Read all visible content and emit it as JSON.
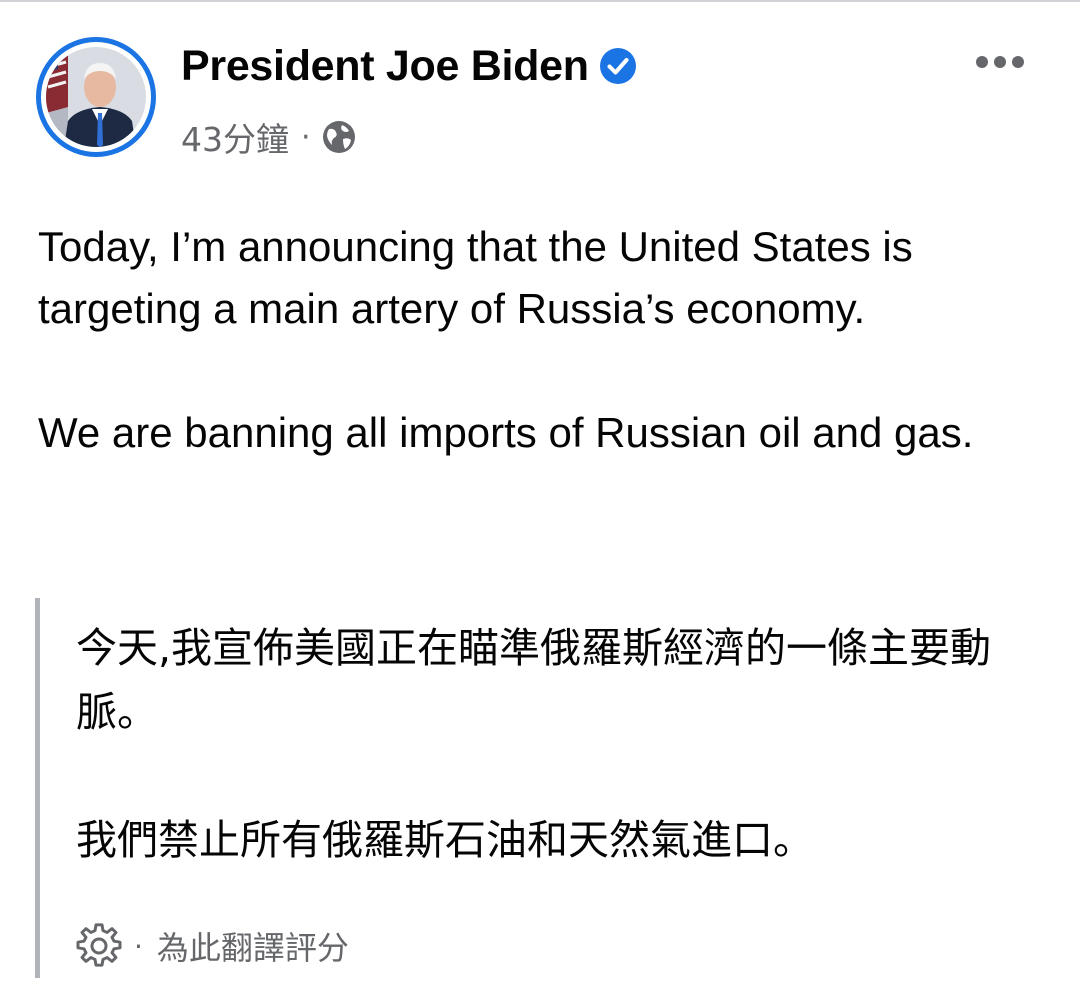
{
  "post": {
    "author": "President Joe Biden",
    "verified": true,
    "timestamp": "43分鐘",
    "meta_separator": "·",
    "privacy_icon": "globe-icon",
    "paragraphs": [
      "Today, I’m announcing that the United States is targeting a main artery of Russia’s economy.",
      "We are banning all imports of Russian oil and gas."
    ],
    "more_icon": "more-horizontal-icon"
  },
  "translation": {
    "paragraphs": [
      "今天,我宣佈美國正在瞄準俄羅斯經濟的一條主要動脈。",
      "我們禁止所有俄羅斯石油和天然氣進口。"
    ],
    "settings_icon": "gear-icon",
    "separator": "·",
    "rate_label": "為此翻譯評分"
  },
  "colors": {
    "accent": "#1b74e4",
    "secondary_text": "#65676b",
    "quote_bar": "#b0b3b8"
  }
}
